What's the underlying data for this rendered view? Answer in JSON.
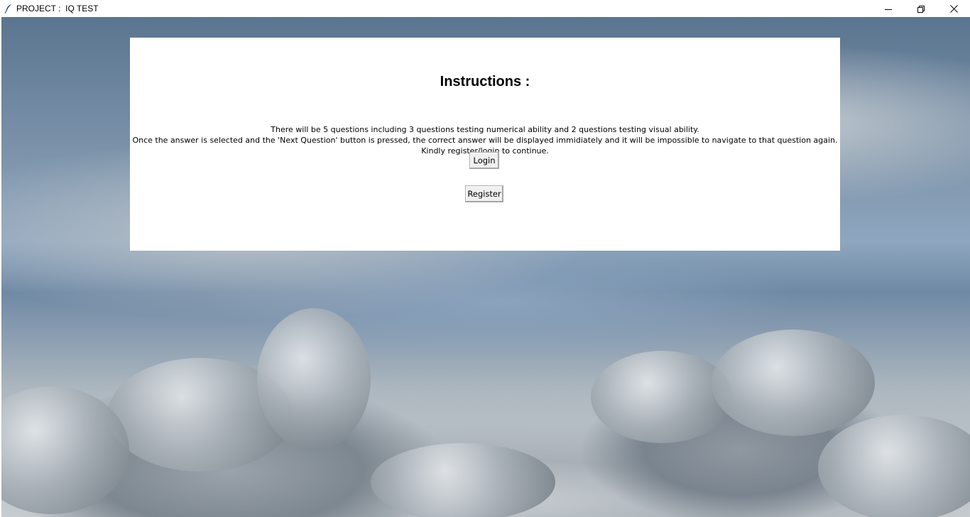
{
  "window": {
    "title": "PROJECT :  IQ TEST",
    "controls": {
      "minimize_icon": "minimize-icon",
      "restore_icon": "restore-icon",
      "close_icon": "close-icon"
    }
  },
  "panel": {
    "title": "Instructions :",
    "lines": [
      "There will be 5 questions including 3 questions testing numerical ability and 2 questions testing visual ability.",
      "Once the answer is selected and the 'Next Question' button is pressed, the correct answer will be displayed immidiately and it will be impossible to navigate to that question again.",
      "Kindly register/login to continue."
    ],
    "login_label": "Login",
    "register_label": "Register"
  },
  "background": {
    "description_colors": {
      "sky": "#7f96ad",
      "clouds": "#c9ced2"
    }
  }
}
